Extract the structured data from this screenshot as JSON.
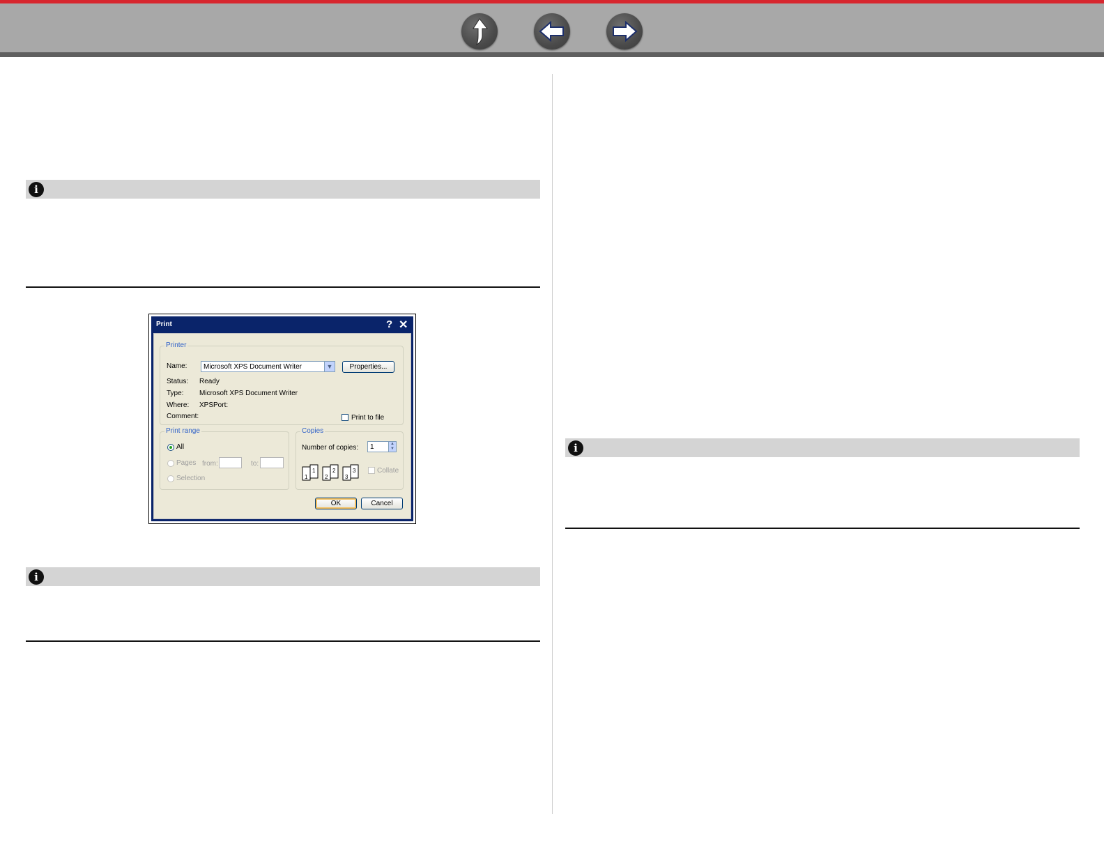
{
  "nav": {
    "up_icon": "up-arrow-icon",
    "back_icon": "back-arrow-icon",
    "forward_icon": "forward-arrow-icon"
  },
  "colors": {
    "accent_red": "#d7262e",
    "topbar_gray": "#a8a8a8",
    "note_bar_gray": "#d4d4d4",
    "dialog_title_blue": "#0a246a"
  },
  "notes": {
    "icon_glyph": "i",
    "icon_name": "info-icon"
  },
  "print_dialog": {
    "title": "Print",
    "help_glyph": "?",
    "close_glyph": "✕",
    "printer_group": {
      "label": "Printer",
      "name_label": "Name:",
      "name_value": "Microsoft XPS Document Writer",
      "properties_button": "Properties...",
      "status_label": "Status:",
      "status_value": "Ready",
      "type_label": "Type:",
      "type_value": "Microsoft XPS Document Writer",
      "where_label": "Where:",
      "where_value": "XPSPort:",
      "comment_label": "Comment:",
      "print_to_file_label": "Print to file"
    },
    "print_range_group": {
      "label": "Print range",
      "all_label": "All",
      "pages_label": "Pages",
      "from_label": "from:",
      "to_label": "to:",
      "selection_label": "Selection"
    },
    "copies_group": {
      "label": "Copies",
      "number_label": "Number of copies:",
      "number_value": "1",
      "collate_label": "Collate",
      "page_digits": [
        "1",
        "1",
        "2",
        "2",
        "3",
        "3"
      ]
    },
    "ok_button": "OK",
    "cancel_button": "Cancel"
  }
}
